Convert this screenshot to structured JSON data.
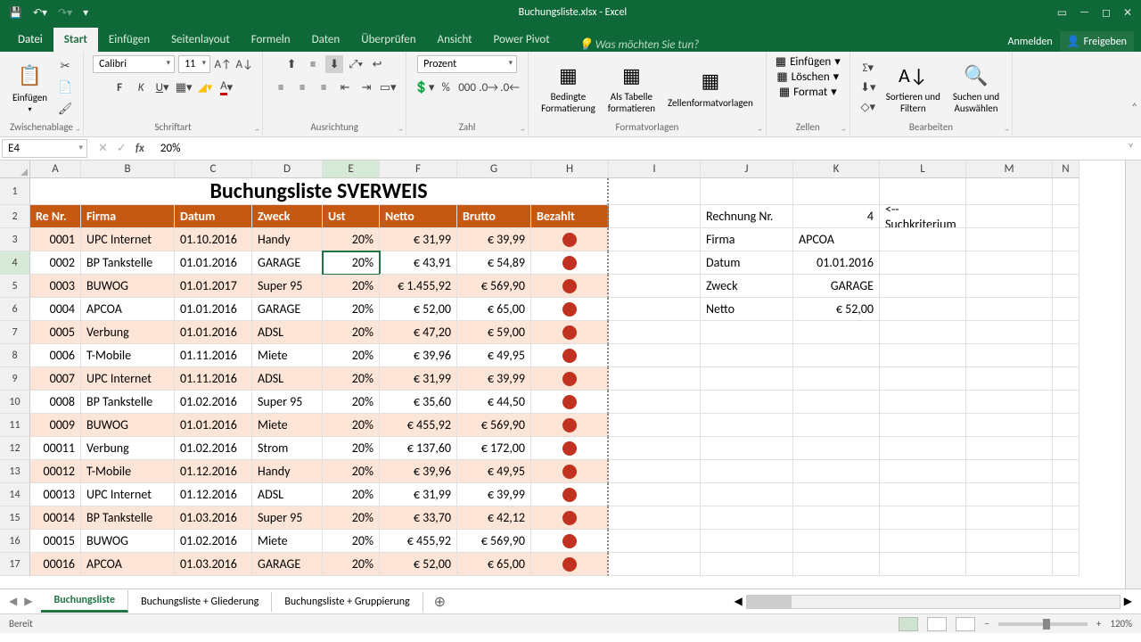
{
  "app": {
    "title": "Buchungsliste.xlsx - Excel"
  },
  "tabs": {
    "file": "Datei",
    "items": [
      "Start",
      "Einfügen",
      "Seitenlayout",
      "Formeln",
      "Daten",
      "Überprüfen",
      "Ansicht",
      "Power Pivot"
    ],
    "active": "Start",
    "tellme": "Was möchten Sie tun?",
    "signin": "Anmelden",
    "share": "Freigeben"
  },
  "ribbon": {
    "clipboard": {
      "paste": "Einfügen",
      "label": "Zwischenablage"
    },
    "font": {
      "name": "Calibri",
      "size": "11",
      "label": "Schriftart"
    },
    "align": {
      "label": "Ausrichtung"
    },
    "number": {
      "format": "Prozent",
      "label": "Zahl"
    },
    "styles": {
      "cond": "Bedingte\nFormatierung",
      "table": "Als Tabelle\nformatieren",
      "cell": "Zellenformatvorlagen",
      "label": "Formatvorlagen"
    },
    "cells": {
      "insert": "Einfügen",
      "delete": "Löschen",
      "format": "Format",
      "label": "Zellen"
    },
    "editing": {
      "sort": "Sortieren und\nFiltern",
      "find": "Suchen und\nAuswählen",
      "label": "Bearbeiten"
    }
  },
  "formula": {
    "cellref": "E4",
    "value": "20%"
  },
  "cols": [
    "A",
    "B",
    "C",
    "D",
    "E",
    "F",
    "G",
    "H",
    "I",
    "J",
    "K",
    "L",
    "M",
    "N"
  ],
  "title_cell": "Buchungsliste SVERWEIS",
  "headers": [
    "Re Nr.",
    "Firma",
    "Datum",
    "Zweck",
    "Ust",
    "Netto",
    "Brutto",
    "Bezahlt"
  ],
  "rows": [
    {
      "n": "0001",
      "f": "UPC Internet",
      "d": "01.10.2016",
      "z": "Handy",
      "u": "20%",
      "ne": "€      31,99",
      "b": "€ 39,99"
    },
    {
      "n": "0002",
      "f": "BP Tankstelle",
      "d": "01.01.2016",
      "z": "GARAGE",
      "u": "20%",
      "ne": "€      43,91",
      "b": "€ 54,89"
    },
    {
      "n": "0003",
      "f": "BUWOG",
      "d": "01.01.2017",
      "z": "Super 95",
      "u": "20%",
      "ne": "€ 1.455,92",
      "b": "€ 569,90"
    },
    {
      "n": "0004",
      "f": "APCOA",
      "d": "01.01.2016",
      "z": "GARAGE",
      "u": "20%",
      "ne": "€      52,00",
      "b": "€ 65,00"
    },
    {
      "n": "0005",
      "f": "Verbung",
      "d": "01.01.2016",
      "z": "ADSL",
      "u": "20%",
      "ne": "€      47,20",
      "b": "€ 59,00"
    },
    {
      "n": "0006",
      "f": "T-Mobile",
      "d": "01.11.2016",
      "z": "Miete",
      "u": "20%",
      "ne": "€      39,96",
      "b": "€ 49,95"
    },
    {
      "n": "0007",
      "f": "UPC Internet",
      "d": "01.11.2016",
      "z": "ADSL",
      "u": "20%",
      "ne": "€      31,99",
      "b": "€ 39,99"
    },
    {
      "n": "0008",
      "f": "BP Tankstelle",
      "d": "01.02.2016",
      "z": "Super 95",
      "u": "20%",
      "ne": "€      35,60",
      "b": "€ 44,50"
    },
    {
      "n": "0009",
      "f": "BUWOG",
      "d": "01.01.2016",
      "z": "Miete",
      "u": "20%",
      "ne": "€    455,92",
      "b": "€ 569,90"
    },
    {
      "n": "00011",
      "f": "Verbung",
      "d": "01.02.2016",
      "z": "Strom",
      "u": "20%",
      "ne": "€    137,60",
      "b": "€ 172,00"
    },
    {
      "n": "00012",
      "f": "T-Mobile",
      "d": "01.12.2016",
      "z": "Handy",
      "u": "20%",
      "ne": "€      39,96",
      "b": "€ 49,95"
    },
    {
      "n": "00013",
      "f": "UPC Internet",
      "d": "01.12.2016",
      "z": "ADSL",
      "u": "20%",
      "ne": "€      31,99",
      "b": "€ 39,99"
    },
    {
      "n": "00014",
      "f": "BP Tankstelle",
      "d": "01.03.2016",
      "z": "Super 95",
      "u": "20%",
      "ne": "€      33,70",
      "b": "€ 42,12"
    },
    {
      "n": "00015",
      "f": "BUWOG",
      "d": "01.02.2016",
      "z": "Miete",
      "u": "20%",
      "ne": "€    455,92",
      "b": "€ 569,90"
    },
    {
      "n": "00016",
      "f": "APCOA",
      "d": "01.03.2016",
      "z": "GARAGE",
      "u": "20%",
      "ne": "€      52,00",
      "b": "€ 65,00"
    }
  ],
  "lookup": {
    "k2": "Rechnung Nr.",
    "v2": "4",
    "l2": "<-- Suchkriterium",
    "k3": "Firma",
    "v3": "APCOA",
    "k4": "Datum",
    "v4": "01.01.2016",
    "k5": "Zweck",
    "v5": "GARAGE",
    "k6": "Netto",
    "v6": "€ 52,00"
  },
  "sheets": {
    "active": "Buchungsliste",
    "others": [
      "Buchungsliste + Gliederung",
      "Buchungsliste + Gruppierung"
    ]
  },
  "status": {
    "ready": "Bereit",
    "zoom": "120%"
  }
}
